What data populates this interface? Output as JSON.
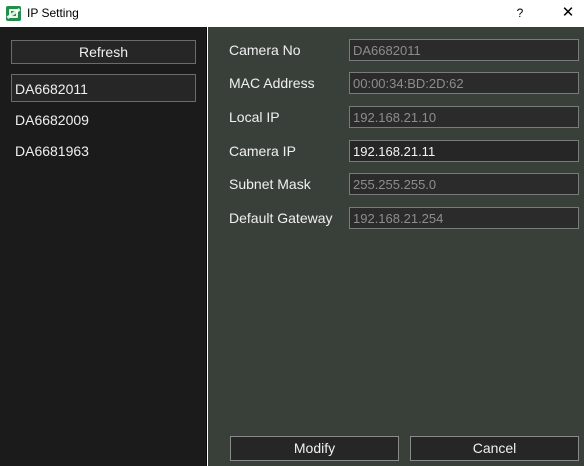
{
  "window": {
    "title": "IP Setting",
    "help_label": "?",
    "close_label": "✕"
  },
  "left": {
    "refresh_label": "Refresh",
    "devices": [
      {
        "label": "DA6682011",
        "selected": true
      },
      {
        "label": "DA6682009",
        "selected": false
      },
      {
        "label": "DA6681963",
        "selected": false
      }
    ]
  },
  "form": {
    "camera_no": {
      "label": "Camera No",
      "value": "DA6682011"
    },
    "mac_address": {
      "label": "MAC Address",
      "value": "00:00:34:BD:2D:62"
    },
    "local_ip": {
      "label": "Local IP",
      "value": "192.168.21.10"
    },
    "camera_ip": {
      "label": "Camera IP",
      "value": "192.168.21.11"
    },
    "subnet_mask": {
      "label": "Subnet Mask",
      "value": "255.255.255.0"
    },
    "default_gateway": {
      "label": "Default Gateway",
      "value": "192.168.21.254"
    }
  },
  "actions": {
    "modify_label": "Modify",
    "cancel_label": "Cancel"
  },
  "colors": {
    "app_icon": "#1f8f4a",
    "left_panel_bg": "#1b1b1b",
    "right_panel_bg": "#394039"
  },
  "icons": {
    "app": "app-icon",
    "help": "help-icon",
    "close": "close-icon"
  }
}
